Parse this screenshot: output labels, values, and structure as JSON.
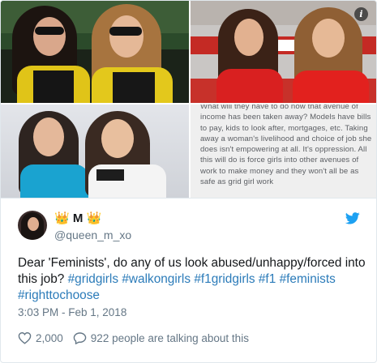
{
  "info_icon": "info-icon",
  "quote_text": "What will they have to do now that avenue of income has been taken away? Models have bills to pay, kids to look after, mortgages, etc. Taking away a woman's livelihood and choice of job she does isn't empowering at all. It's oppression. All this will do is force girls into other avenues of work to make money and they won't all be as safe as grid girl work",
  "tweet": {
    "crown_left": "👑",
    "display_letter": "M",
    "crown_right": "👑",
    "handle": "@queen_m_xo",
    "text_plain": "Dear 'Feminists', do any of us look abused/unhappy/forced into this job? ",
    "hashtags": [
      "#gridgirls",
      "#walkongirls",
      "#f1gridgirls",
      "#f1",
      "#feminists",
      "#righttochoose"
    ],
    "timestamp": "3:03 PM - Feb 1, 2018",
    "likes": "2,000",
    "talking": "922 people are talking about this"
  },
  "icons": {
    "twitter": "twitter-bird-icon",
    "like": "heart-icon",
    "reply": "speech-bubble-icon"
  },
  "colors": {
    "link": "#2b7bb9",
    "twitter_blue": "#1da1f2",
    "muted": "#657786"
  }
}
